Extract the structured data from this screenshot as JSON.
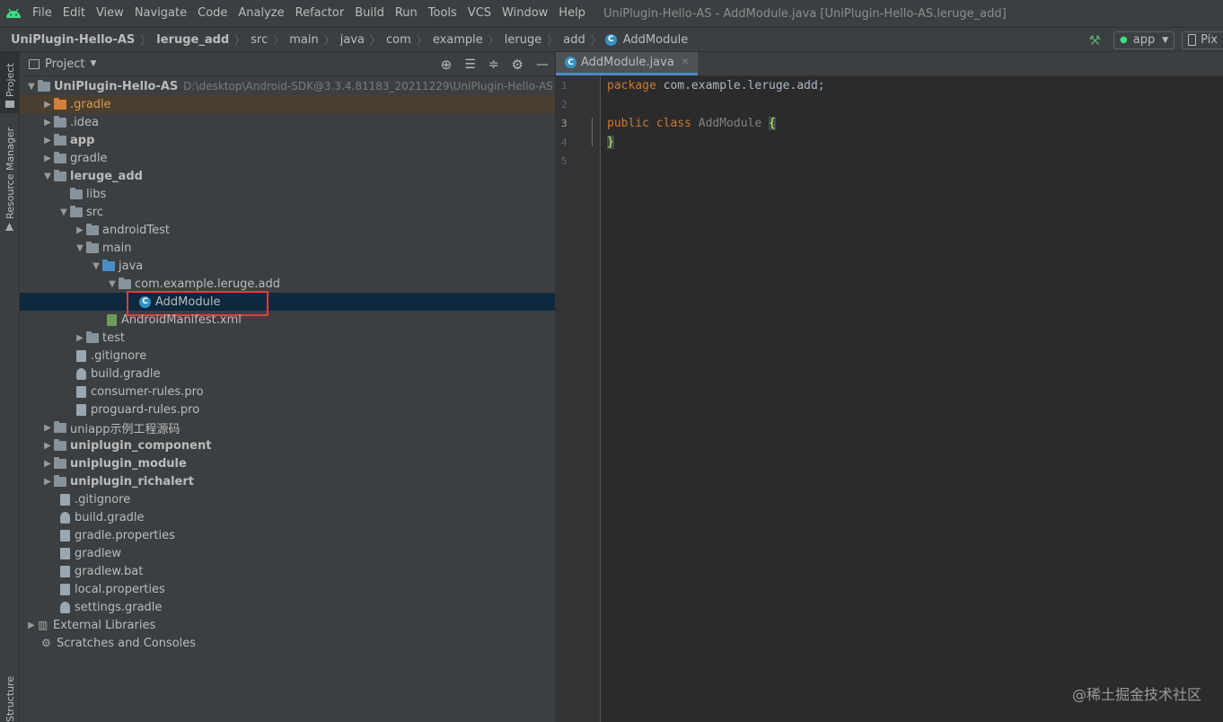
{
  "menu": {
    "items": [
      "File",
      "Edit",
      "View",
      "Navigate",
      "Code",
      "Analyze",
      "Refactor",
      "Build",
      "Run",
      "Tools",
      "VCS",
      "Window",
      "Help"
    ],
    "window_title": "UniPlugin-Hello-AS - AddModule.java [UniPlugin-Hello-AS.leruge_add]"
  },
  "breadcrumb": [
    "UniPlugin-Hello-AS",
    "leruge_add",
    "src",
    "main",
    "java",
    "com",
    "example",
    "leruge",
    "add",
    "AddModule"
  ],
  "toolbar": {
    "run_config": "app",
    "device": "Pix"
  },
  "side": {
    "project_label": "Project",
    "resource_label": "Resource Manager",
    "structure_label": "Structure"
  },
  "project_panel": {
    "title": "Project"
  },
  "tree": [
    {
      "label": "UniPlugin-Hello-AS",
      "hint": "D:\\desktop\\Android-SDK@3.3.4.81183_20211229\\UniPlugin-Hello-AS"
    },
    {
      "label": ".gradle"
    },
    {
      "label": ".idea"
    },
    {
      "label": "app"
    },
    {
      "label": "gradle"
    },
    {
      "label": "leruge_add"
    },
    {
      "label": "libs"
    },
    {
      "label": "src"
    },
    {
      "label": "androidTest"
    },
    {
      "label": "main"
    },
    {
      "label": "java"
    },
    {
      "label": "com.example.leruge.add"
    },
    {
      "label": "AddModule"
    },
    {
      "label": "AndroidManifest.xml"
    },
    {
      "label": "test"
    },
    {
      "label": ".gitignore"
    },
    {
      "label": "build.gradle"
    },
    {
      "label": "consumer-rules.pro"
    },
    {
      "label": "proguard-rules.pro"
    },
    {
      "label": "uniapp示例工程源码"
    },
    {
      "label": "uniplugin_component"
    },
    {
      "label": "uniplugin_module"
    },
    {
      "label": "uniplugin_richalert"
    },
    {
      "label": ".gitignore"
    },
    {
      "label": "build.gradle"
    },
    {
      "label": "gradle.properties"
    },
    {
      "label": "gradlew"
    },
    {
      "label": "gradlew.bat"
    },
    {
      "label": "local.properties"
    },
    {
      "label": "settings.gradle"
    },
    {
      "label": "External Libraries"
    },
    {
      "label": "Scratches and Consoles"
    }
  ],
  "editor": {
    "tab_label": "AddModule.java",
    "line_numbers": [
      "1",
      "2",
      "3",
      "4",
      "5"
    ],
    "code": {
      "l1_kw": "package",
      "l1_rest": " com.example.leruge.add;",
      "l3_kw": "public class",
      "l3_name": " AddModule ",
      "l3_brace": "{",
      "l4_brace": "}"
    }
  },
  "watermark": "@稀土掘金技术社区",
  "colors": {
    "selection": "#0d293e",
    "highlight_box": "#e03c3c",
    "tab_underline": "#4a88c7"
  }
}
